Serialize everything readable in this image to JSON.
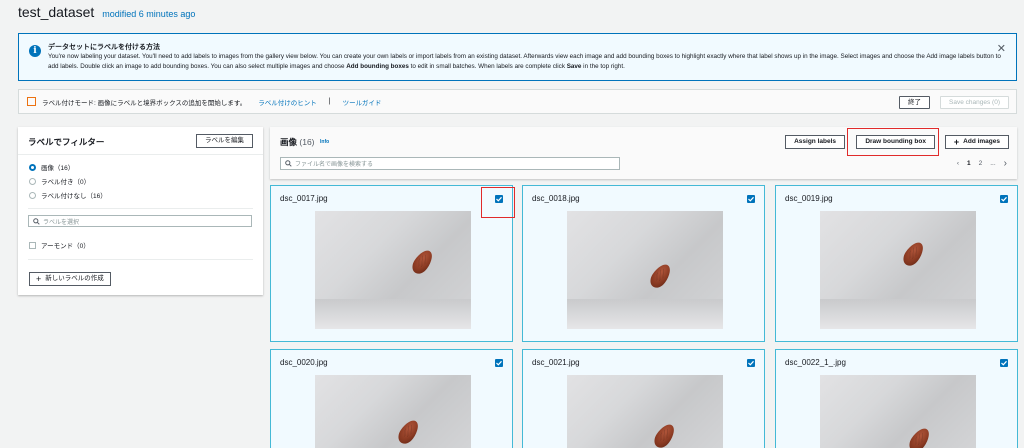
{
  "header": {
    "title": "test_dataset",
    "modified": "modified 6 minutes ago"
  },
  "flash": {
    "title": "データセットにラベルを付ける方法",
    "body_1": "You're now labeling your dataset. You'll need to add labels to images from the gallery view below. You can create your own labels or import labels from an existing dataset. Afterwards view each image and add bounding boxes to highlight exactly where that label shows up in the image. Select images and choose the Add image labels button to add labels. Double click an image to add bounding boxes. You can also select multiple images and choose ",
    "body_bold_1": "Add bounding boxes",
    "body_2": " to edit in small batches. When labels are complete click ",
    "body_bold_2": "Save",
    "body_3": " in the top right."
  },
  "modebar": {
    "mode_text": "ラベル付けモード: 画像にラベルと境界ボックスの追加を開始します。",
    "hint_link": "ラベル付けのヒント",
    "separator": "|",
    "tool_guide_link": "ツールガイド",
    "done_label": "終了",
    "save_label": "Save changes (0)"
  },
  "filter": {
    "title": "ラベルでフィルター",
    "edit_label": "ラベルを編集",
    "options": [
      {
        "label": "画像（16）",
        "selected": true
      },
      {
        "label": "ラベル付き（0）",
        "selected": false
      },
      {
        "label": "ラベル付けなし（16）",
        "selected": false
      }
    ],
    "search_placeholder": "ラベルを選択",
    "labels": [
      {
        "label": "アーモンド（0）"
      }
    ],
    "new_label_button": "新しいラベルの作成"
  },
  "gallery": {
    "title": "画像",
    "count": "(16)",
    "info": "Info",
    "search_placeholder": "ファイル名で画像を検索する",
    "assign_labels": "Assign labels",
    "draw_bounding_box": "Draw bounding box",
    "add_images": "Add images",
    "pages": [
      "1",
      "2",
      "..."
    ],
    "images": [
      {
        "name": "dsc_0017.jpg",
        "checked": true
      },
      {
        "name": "dsc_0018.jpg",
        "checked": true
      },
      {
        "name": "dsc_0019.jpg",
        "checked": true
      },
      {
        "name": "dsc_0020.jpg",
        "checked": true
      },
      {
        "name": "dsc_0021.jpg",
        "checked": true
      },
      {
        "name": "dsc_0022_1_.jpg",
        "checked": true
      }
    ]
  },
  "colors": {
    "accent": "#0073bb",
    "selected_border": "#44b9d6",
    "highlight": "#e02b2b",
    "mode_icon": "#ec7211"
  }
}
